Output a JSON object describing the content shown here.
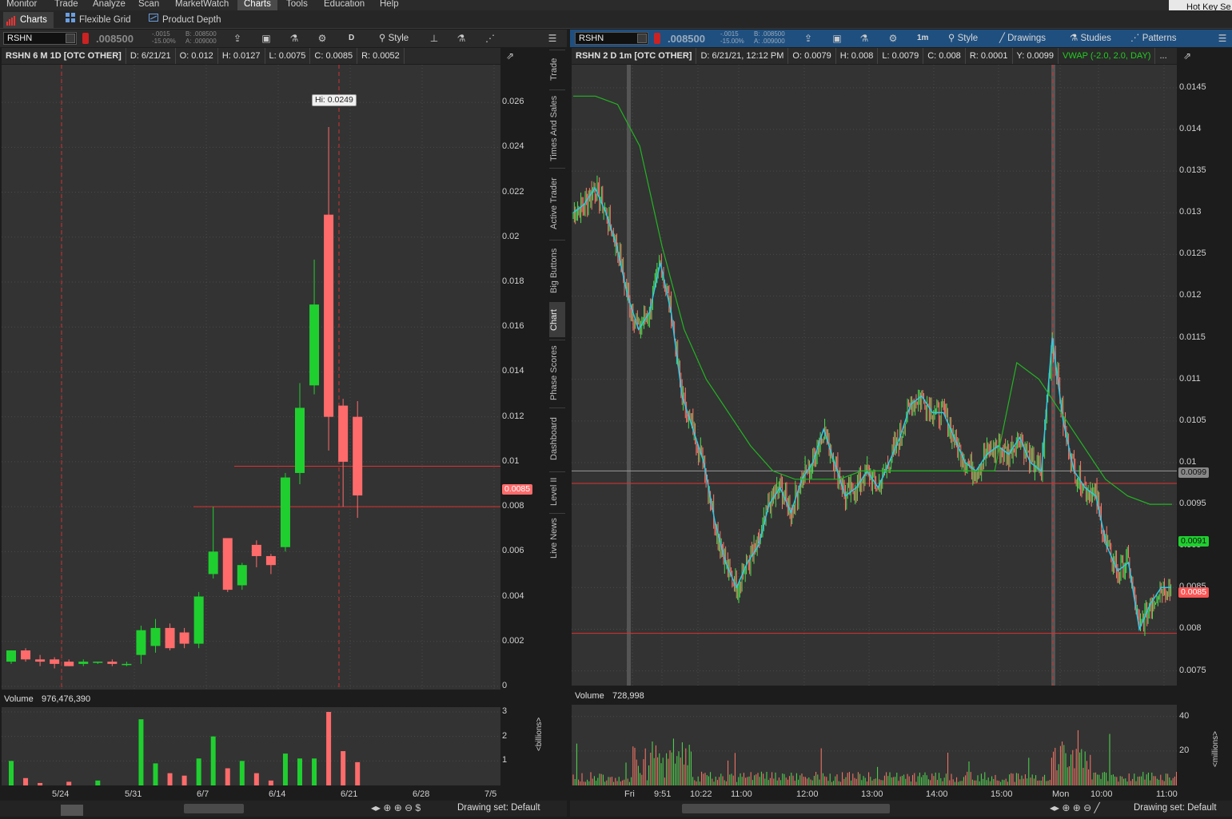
{
  "menu": [
    "Monitor",
    "Trade",
    "Analyze",
    "Scan",
    "MarketWatch",
    "Charts",
    "Tools",
    "Education",
    "Help"
  ],
  "menu_active": "Charts",
  "hotkey_label": "Hot Key Se",
  "subtabs": [
    "Charts",
    "Flexible Grid",
    "Product Depth"
  ],
  "left": {
    "symbol": "RSHN",
    "price": ".008500",
    "change": "-.0015",
    "change_pct": "-15.00%",
    "bid": "B: .008500",
    "ask": "A: .009000",
    "aggregation": "D",
    "style_label": "Style",
    "info": [
      "RSHN 6 M 1D [OTC OTHER]",
      "D: 6/21/21",
      "O: 0.012",
      "H: 0.0127",
      "L: 0.0075",
      "C: 0.0085",
      "R: 0.0052"
    ],
    "hi_tag": "Hi: 0.0249",
    "price_tag": "0.0085",
    "volume_label": "Volume",
    "volume_value": "976,476,390",
    "volume_unit": "<billions>",
    "drawing_set": "Drawing set: Default"
  },
  "right": {
    "symbol": "RSHN",
    "price": ".008500",
    "change": "-.0015",
    "change_pct": "-15.00%",
    "bid": "B: .008500",
    "ask": "A: .009000",
    "aggregation": "1m",
    "style_label": "Style",
    "drawings_label": "Drawings",
    "studies_label": "Studies",
    "patterns_label": "Patterns",
    "info": [
      "RSHN 2 D 1m [OTC OTHER]",
      "D: 6/21/21, 12:12 PM",
      "O: 0.0079",
      "H: 0.008",
      "L: 0.0079",
      "C: 0.008",
      "R: 0.0001",
      "Y: 0.0099"
    ],
    "vwap_label": "VWAP (-2.0, 2.0, DAY)",
    "more": "...",
    "tags": {
      "gray": "0.0099",
      "green": "0.0091",
      "red": "0.0085"
    },
    "volume_label": "Volume",
    "volume_value": "728,998",
    "volume_unit": "<millions>",
    "drawing_set": "Drawing set: Default"
  },
  "side_tabs": [
    "Trade",
    "Times And Sales",
    "Active Trader",
    "Big Buttons",
    "Chart",
    "Phase Scores",
    "Dashboard",
    "Level II",
    "Live News"
  ],
  "side_tab_active": "Chart",
  "colors": {
    "up": "#1fcf2f",
    "down": "#ff6b6b",
    "bg": "#333333",
    "vwap": "#22b522",
    "ema": "#2ec8e8",
    "hline": "#e03030"
  },
  "chart_data": [
    {
      "type": "candlestick",
      "title": "RSHN 6 M 1D [OTC OTHER]",
      "ylim": [
        0,
        0.027
      ],
      "yticks": [
        0,
        0.002,
        0.004,
        0.006,
        0.008,
        0.01,
        0.012,
        0.014,
        0.016,
        0.018,
        0.02,
        0.022,
        0.024,
        0.026
      ],
      "ytick_labels": [
        "0",
        "0.002",
        "0.004",
        "0.006",
        "0.008",
        "0.01",
        "0.012",
        "0.014",
        "0.016",
        "0.018",
        "0.02",
        "0.022",
        "0.024",
        "0.026"
      ],
      "xtick_labels": [
        "5/24",
        "5/31",
        "6/7",
        "6/14",
        "6/21",
        "6/28",
        "7/5"
      ],
      "candles": [
        {
          "o": 0.0011,
          "h": 0.0016,
          "l": 0.001,
          "c": 0.0016
        },
        {
          "o": 0.0016,
          "h": 0.0017,
          "l": 0.0011,
          "c": 0.0012
        },
        {
          "o": 0.0012,
          "h": 0.0014,
          "l": 0.0009,
          "c": 0.0011
        },
        {
          "o": 0.0012,
          "h": 0.0013,
          "l": 0.0008,
          "c": 0.001
        },
        {
          "o": 0.0011,
          "h": 0.0012,
          "l": 0.0009,
          "c": 0.0009
        },
        {
          "o": 0.001,
          "h": 0.0012,
          "l": 0.0009,
          "c": 0.0011
        },
        {
          "o": 0.0011,
          "h": 0.0011,
          "l": 0.001,
          "c": 0.0011
        },
        {
          "o": 0.0011,
          "h": 0.0012,
          "l": 0.0009,
          "c": 0.001
        },
        {
          "o": 0.001,
          "h": 0.0011,
          "l": 0.0009,
          "c": 0.001
        },
        {
          "o": 0.0014,
          "h": 0.0027,
          "l": 0.001,
          "c": 0.0025
        },
        {
          "o": 0.0018,
          "h": 0.003,
          "l": 0.0015,
          "c": 0.0026
        },
        {
          "o": 0.0026,
          "h": 0.0028,
          "l": 0.0016,
          "c": 0.0017
        },
        {
          "o": 0.0024,
          "h": 0.0026,
          "l": 0.0017,
          "c": 0.0019
        },
        {
          "o": 0.0019,
          "h": 0.0042,
          "l": 0.0017,
          "c": 0.004
        },
        {
          "o": 0.005,
          "h": 0.008,
          "l": 0.0048,
          "c": 0.006
        },
        {
          "o": 0.0066,
          "h": 0.0066,
          "l": 0.0042,
          "c": 0.0043
        },
        {
          "o": 0.0045,
          "h": 0.0055,
          "l": 0.0043,
          "c": 0.0054
        },
        {
          "o": 0.0063,
          "h": 0.0065,
          "l": 0.0053,
          "c": 0.0058
        },
        {
          "o": 0.0058,
          "h": 0.0059,
          "l": 0.005,
          "c": 0.0054
        },
        {
          "o": 0.0062,
          "h": 0.0095,
          "l": 0.006,
          "c": 0.0093
        },
        {
          "o": 0.0095,
          "h": 0.0135,
          "l": 0.009,
          "c": 0.0124
        },
        {
          "o": 0.0134,
          "h": 0.019,
          "l": 0.013,
          "c": 0.017
        },
        {
          "o": 0.021,
          "h": 0.0249,
          "l": 0.0105,
          "c": 0.012
        },
        {
          "o": 0.0125,
          "h": 0.0128,
          "l": 0.008,
          "c": 0.01
        },
        {
          "o": 0.012,
          "h": 0.0127,
          "l": 0.0075,
          "c": 0.0085
        }
      ],
      "volume_ylim": [
        0,
        3
      ],
      "volume_ticks": [
        "3",
        "2",
        "1"
      ],
      "volume": [
        1.0,
        0.3,
        0.1,
        0.0,
        0.15,
        0.0,
        0.2,
        0.0,
        0.0,
        2.7,
        0.9,
        0.5,
        0.4,
        1.1,
        2.0,
        0.7,
        1.0,
        0.5,
        0.2,
        1.3,
        1.1,
        1.1,
        3.0,
        1.4,
        0.95
      ],
      "hlines": [
        0.0098,
        0.008
      ]
    },
    {
      "type": "candlestick",
      "title": "RSHN 2 D 1m [OTC OTHER]",
      "ylim": [
        0.0074,
        0.0147
      ],
      "yticks": [
        0.0075,
        0.008,
        0.0085,
        0.009,
        0.0095,
        0.01,
        0.0105,
        0.011,
        0.0115,
        0.012,
        0.0125,
        0.013,
        0.0135,
        0.014,
        0.0145
      ],
      "ytick_labels": [
        "0.0075",
        "0.008",
        "0.0085",
        "0.009",
        "0.0095",
        "0.01",
        "0.0105",
        "0.011",
        "0.0115",
        "0.012",
        "0.0125",
        "0.013",
        "0.0135",
        "0.014",
        "0.0145"
      ],
      "xtick_labels": [
        "Fri",
        "9:51",
        "10:22",
        "11:00",
        "12:00",
        "13:00",
        "14:00",
        "15:00",
        "Mon",
        "10:00",
        "11:00"
      ],
      "price_path": [
        0.013,
        0.0131,
        0.0133,
        0.013,
        0.0126,
        0.012,
        0.0116,
        0.0118,
        0.0124,
        0.0118,
        0.0108,
        0.0104,
        0.01,
        0.0093,
        0.0088,
        0.0085,
        0.0088,
        0.009,
        0.0095,
        0.0097,
        0.0094,
        0.0098,
        0.01,
        0.0104,
        0.01,
        0.0096,
        0.0097,
        0.0099,
        0.0097,
        0.01,
        0.0103,
        0.0107,
        0.0108,
        0.0106,
        0.0106,
        0.0103,
        0.01,
        0.0099,
        0.0101,
        0.0102,
        0.0101,
        0.0103,
        0.01,
        0.0099,
        0.0115,
        0.0105,
        0.0099,
        0.0097,
        0.0096,
        0.009,
        0.0087,
        0.0088,
        0.008,
        0.0083,
        0.0085,
        0.0085
      ],
      "vwap_path": [
        0.0144,
        0.0144,
        0.0143,
        0.0138,
        0.0126,
        0.0116,
        0.011,
        0.0106,
        0.0102,
        0.0099,
        0.0098,
        0.0098,
        0.0098,
        0.0099,
        0.0099,
        0.0099,
        0.0099,
        0.0099,
        0.0099,
        0.0099,
        0.0112,
        0.011,
        0.0106,
        0.0102,
        0.0098,
        0.0096,
        0.0095,
        0.0095
      ],
      "volume_ylim": [
        0,
        45
      ],
      "volume_ticks": [
        "40",
        "20"
      ],
      "hlines": [
        0.00975,
        0.00795
      ],
      "gray_hline": 0.0099
    }
  ]
}
